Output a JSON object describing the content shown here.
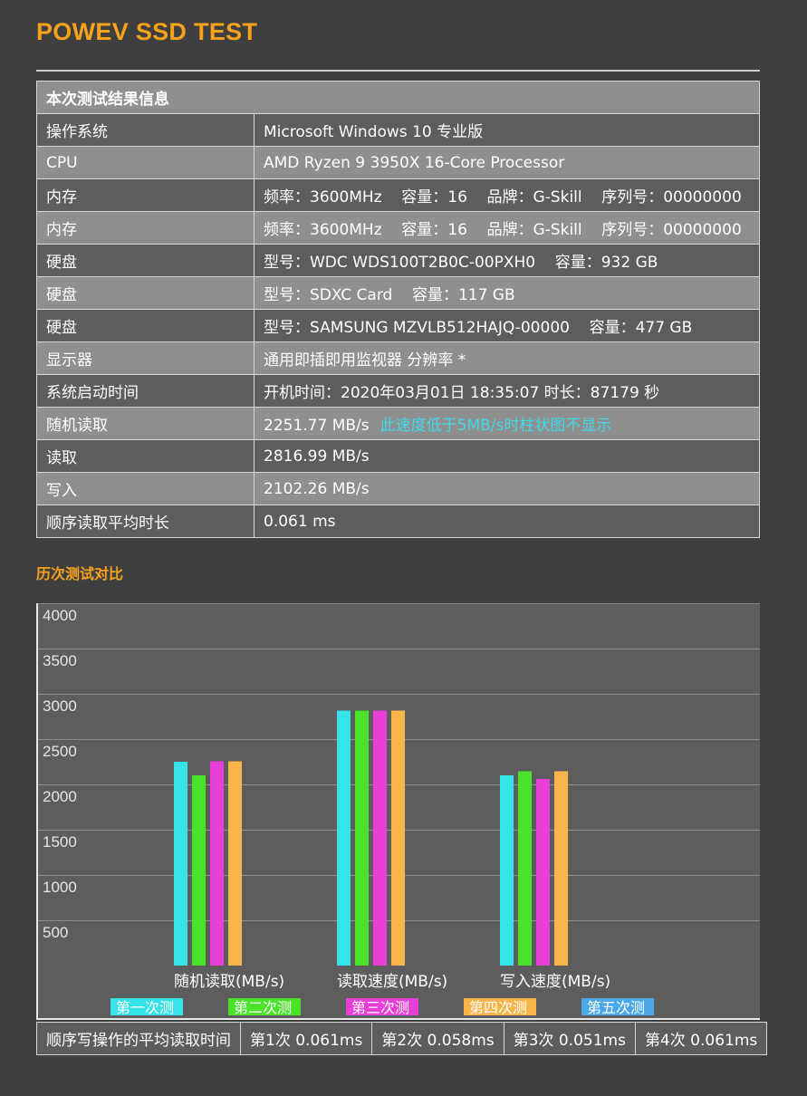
{
  "app": {
    "title": "POWEV SSD TEST"
  },
  "info": {
    "header": "本次测试结果信息",
    "rows": [
      {
        "key": "操作系统",
        "value": "Microsoft Windows 10 专业版"
      },
      {
        "key": "CPU",
        "value": "AMD Ryzen 9 3950X 16-Core Processor"
      },
      {
        "key": "内存",
        "value": "频率：3600MHz    容量：16    品牌：G-Skill    序列号：00000000"
      },
      {
        "key": "内存",
        "value": "频率：3600MHz    容量：16    品牌：G-Skill    序列号：00000000"
      },
      {
        "key": "硬盘",
        "value": "型号：WDC WDS100T2B0C-00PXH0    容量：932 GB"
      },
      {
        "key": "硬盘",
        "value": "型号：SDXC Card    容量：117 GB"
      },
      {
        "key": "硬盘",
        "value": "型号：SAMSUNG MZVLB512HAJQ-00000    容量：477 GB"
      },
      {
        "key": "显示器",
        "value": "通用即插即用监视器 分辨率 *"
      },
      {
        "key": "系统启动时间",
        "value": "开机时间：2020年03月01日 18:35:07 时长：87179 秒"
      },
      {
        "key": "随机读取",
        "value": "2251.77 MB/s",
        "note": "此速度低于5MB/s时柱状图不显示"
      },
      {
        "key": "读取",
        "value": "2816.99 MB/s"
      },
      {
        "key": "写入",
        "value": "2102.26 MB/s"
      },
      {
        "key": "顺序读取平均时长",
        "value": "0.061 ms"
      }
    ]
  },
  "history": {
    "title": "历次测试对比"
  },
  "chart_data": {
    "type": "bar",
    "categories": [
      "随机读取(MB/s)",
      "读取速度(MB/s)",
      "写入速度(MB/s)"
    ],
    "ylim": [
      0,
      4000
    ],
    "yticks": [
      "4000",
      "3500",
      "3000",
      "2500",
      "2000",
      "1500",
      "1000",
      "500"
    ],
    "grid": true,
    "legend_position": "bottom",
    "series": [
      {
        "name": "第一次测试",
        "color": "#35e3e8",
        "values": [
          2250,
          2815,
          2100
        ]
      },
      {
        "name": "第二次测试",
        "color": "#4ae32a",
        "values": [
          2100,
          2815,
          2145
        ]
      },
      {
        "name": "第三次测试",
        "color": "#e83fd8",
        "values": [
          2255,
          2815,
          2060
        ]
      },
      {
        "name": "第四次测试",
        "color": "#f8b54a",
        "values": [
          2255,
          2815,
          2145
        ]
      },
      {
        "name": "第五次测试",
        "color": "#4aa8e8",
        "values": [
          0,
          0,
          0
        ]
      }
    ]
  },
  "latency": {
    "label": "顺序写操作的平均读取时间",
    "values": [
      "第1次 0.061ms",
      "第2次 0.058ms",
      "第3次 0.051ms",
      "第4次 0.061ms"
    ]
  }
}
